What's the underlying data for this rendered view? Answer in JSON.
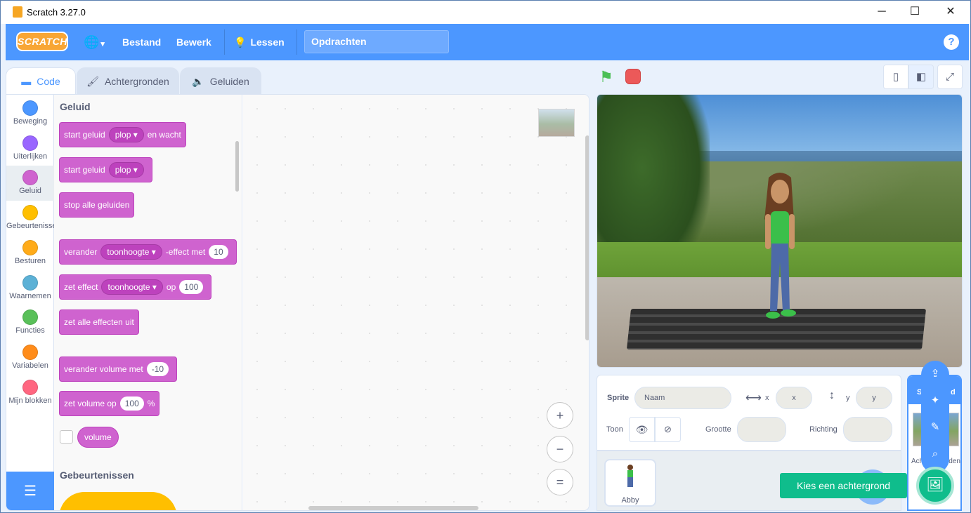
{
  "window": {
    "title": "Scratch 3.27.0",
    "minimize": "─",
    "maximize": "☐",
    "close": "✕"
  },
  "menubar": {
    "logo": "SCRATCH",
    "language_icon": "🌐",
    "language_caret": "▾",
    "file": "Bestand",
    "edit": "Bewerk",
    "tutorials_icon": "💡",
    "tutorials": "Lessen",
    "project_title": "Opdrachten",
    "help": "?"
  },
  "tabs": [
    {
      "label": "Code",
      "icon": "code-icon"
    },
    {
      "label": "Achtergronden",
      "icon": "brush-icon"
    },
    {
      "label": "Geluiden",
      "icon": "speaker-icon"
    }
  ],
  "categories": [
    {
      "label": "Beweging",
      "color": "#4c97ff"
    },
    {
      "label": "Uiterlijken",
      "color": "#9966ff"
    },
    {
      "label": "Geluid",
      "color": "#cf63cf",
      "selected": true
    },
    {
      "label": "Gebeurtenissen",
      "color": "#ffbf00"
    },
    {
      "label": "Besturen",
      "color": "#ffab19"
    },
    {
      "label": "Waarnemen",
      "color": "#5cb1d6"
    },
    {
      "label": "Functies",
      "color": "#59c059"
    },
    {
      "label": "Variabelen",
      "color": "#ff8c1a"
    },
    {
      "label": "Mijn blokken",
      "color": "#ff6680"
    }
  ],
  "palette": {
    "section_sound": "Geluid",
    "section_events": "Gebeurtenissen",
    "blocks": {
      "b1": {
        "pre": "start geluid",
        "dd": "plop ▾",
        "post": "en wacht"
      },
      "b2": {
        "pre": "start geluid",
        "dd": "plop ▾"
      },
      "b3": {
        "pre": "stop alle geluiden"
      },
      "b4": {
        "pre": "verander",
        "dd": "toonhoogte ▾",
        "mid": "-effect met",
        "num": "10"
      },
      "b5": {
        "pre": "zet effect",
        "dd": "toonhoogte ▾",
        "mid": "op",
        "num": "100"
      },
      "b6": {
        "pre": "zet alle effecten uit"
      },
      "b7": {
        "pre": "verander volume met",
        "num": "-10"
      },
      "b8": {
        "pre": "zet volume op",
        "num": "100",
        "post": "%"
      },
      "b9": {
        "pre": "volume"
      }
    }
  },
  "zoom": {
    "in": "+",
    "out": "−",
    "reset": "="
  },
  "stage_controls": {
    "green_flag": "⚑",
    "small_stage": "▯",
    "normal_stage": "◧",
    "fullscreen": "⤢"
  },
  "sprite_info": {
    "sprite_label": "Sprite",
    "name_placeholder": "Naam",
    "x_label": "x",
    "x_placeholder": "x",
    "y_label": "y",
    "y_placeholder": "y",
    "show_label": "Toon",
    "size_label": "Grootte",
    "direction_label": "Richting"
  },
  "sprites": [
    {
      "name": "Abby"
    }
  ],
  "stage_pane": {
    "header": "S",
    "header_tail": "d",
    "label_left": "Ach",
    "label_right": "den"
  },
  "backdrop_menu": {
    "tooltip": "Kies een achtergrond",
    "upload": "⇪",
    "surprise": "✦",
    "paint": "✎",
    "search": "⌕",
    "main": "🖼"
  }
}
